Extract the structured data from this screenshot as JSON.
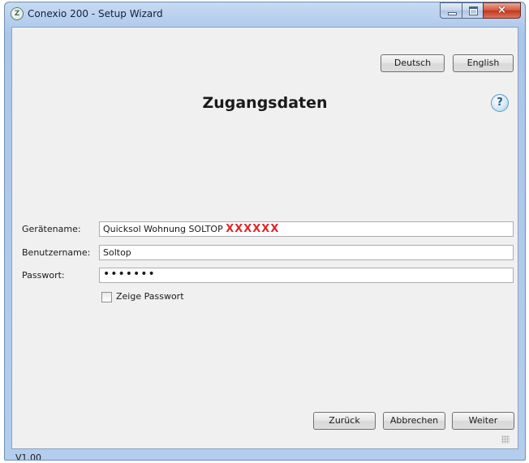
{
  "window": {
    "title": "Conexio 200 - Setup Wizard",
    "app_icon": "conexio-logo-icon",
    "controls": {
      "minimize": "minimize-icon",
      "maximize": "maximize-icon",
      "close": "×"
    }
  },
  "language": {
    "german": "Deutsch",
    "english": "English"
  },
  "page": {
    "heading": "Zugangsdaten",
    "help": "?"
  },
  "form": {
    "device_name_label": "Gerätename:",
    "device_name_value": "Quicksol Wohnung SOLTOP",
    "device_name_redacted": "XXXXXX",
    "username_label": "Benutzername:",
    "username_value": "Soltop",
    "password_label": "Passwort:",
    "password_value": "•••••••",
    "show_password_label": "Zeige Passwort",
    "show_password_checked": false
  },
  "nav": {
    "back": "Zurück",
    "cancel": "Abbrechen",
    "next": "Weiter"
  },
  "footer": {
    "version": "V1.00"
  },
  "colors": {
    "redaction": "#e0262a",
    "title_bar": "#b3cdee",
    "close_button": "#c2361c"
  }
}
